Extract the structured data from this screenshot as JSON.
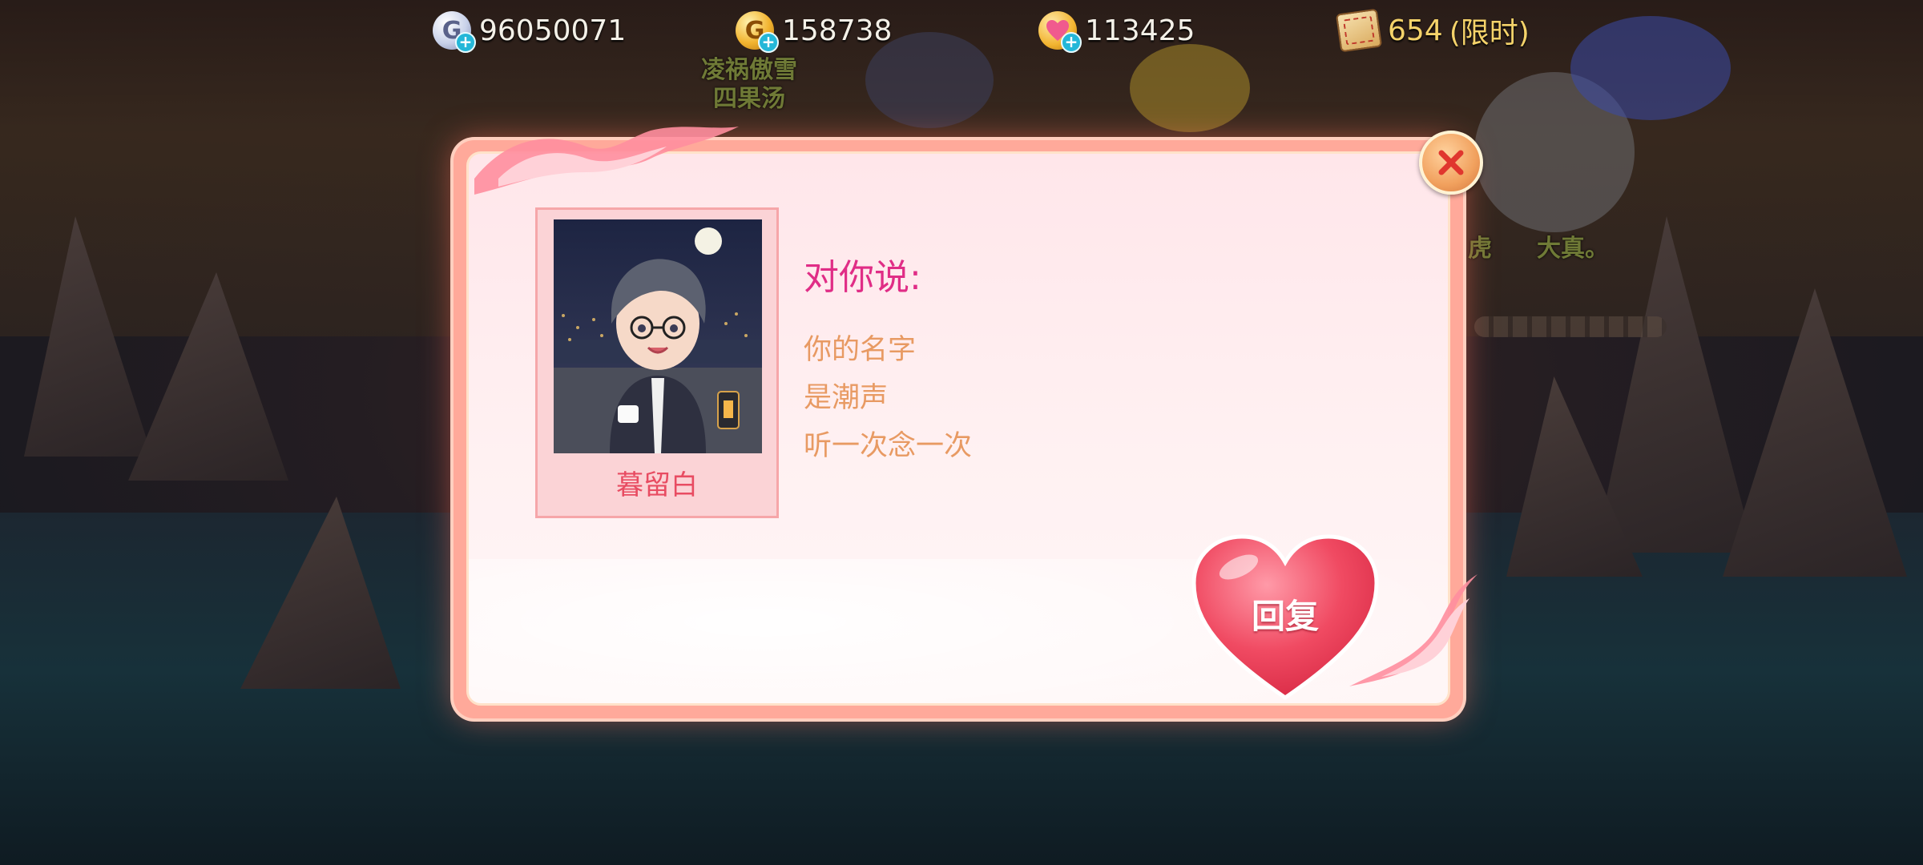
{
  "topbar": {
    "silver": {
      "icon": "silver-coin-icon",
      "letter": "G",
      "value": "96050071",
      "color": "#c9d2ea"
    },
    "gold": {
      "icon": "gold-coin-icon",
      "letter": "G",
      "value": "158738",
      "color": "#f2b430"
    },
    "heart": {
      "icon": "heart-coin-icon",
      "value": "113425",
      "color": "#f06aa0"
    },
    "ticket": {
      "icon": "ticket-icon",
      "value": "654",
      "suffix": "(限时)",
      "color": "#f5d36a"
    }
  },
  "world": {
    "names": [
      "凌祸傲雪",
      "四果汤",
      "虎",
      "大真。"
    ]
  },
  "dialog": {
    "sender_name": "暮留白",
    "title": "对你说:",
    "lines": [
      "你的名字",
      "是潮声",
      "听一次念一次"
    ],
    "reply_label": "回复",
    "close_icon": "close-icon",
    "accent_color": "#e02d86"
  }
}
